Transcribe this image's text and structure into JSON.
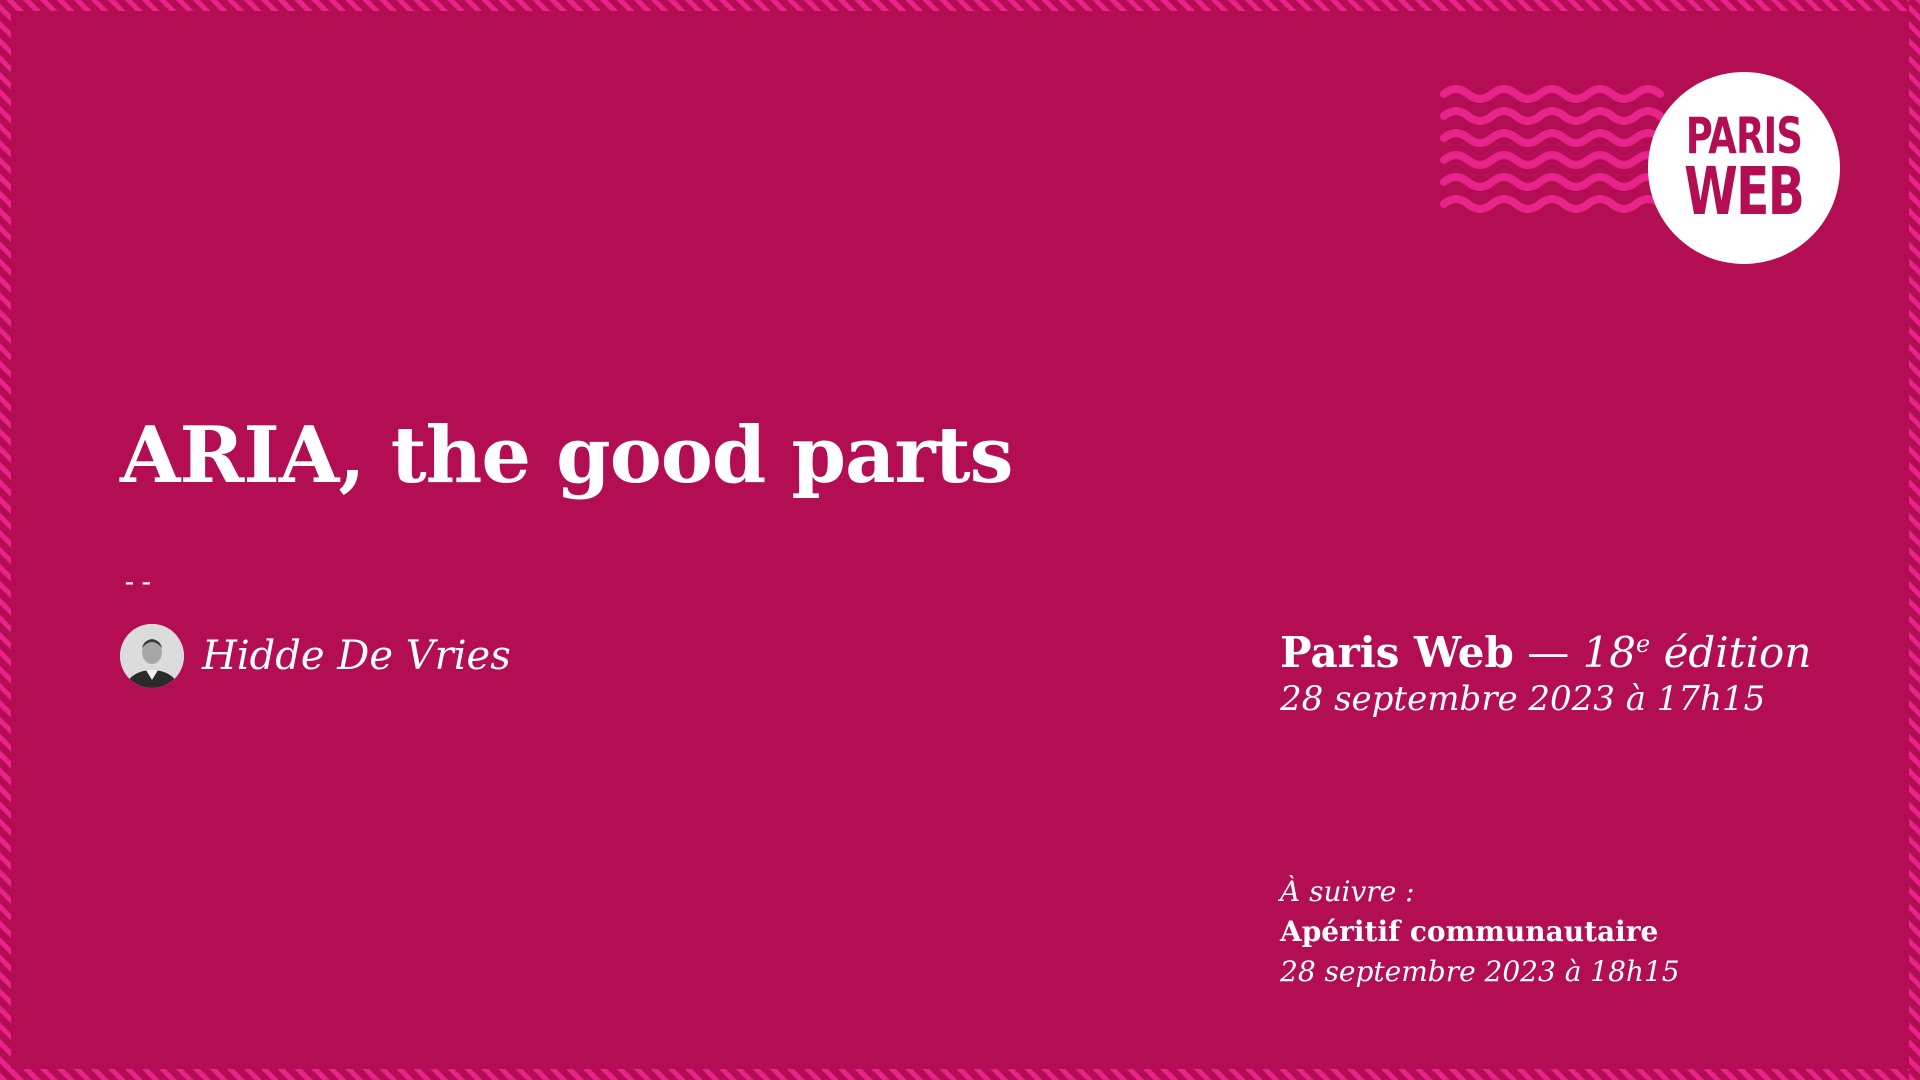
{
  "slide": {
    "title": "ARIA, the good parts",
    "separator": "--",
    "speaker": {
      "name": "Hidde De Vries"
    }
  },
  "logo": {
    "line1": "PARIS",
    "line2": "WEB"
  },
  "event": {
    "name": "Paris Web",
    "dash": " — ",
    "edition_number": "18",
    "edition_sup": "e",
    "edition_word": " édition",
    "date": "28 septembre 2023 à 17h15"
  },
  "next": {
    "label": "À suivre :",
    "title": "Apéritif communautaire",
    "date": "28 septembre 2023 à 18h15"
  },
  "colors": {
    "background": "#b30e53",
    "accent": "#e8248a",
    "text": "#ffffff"
  }
}
